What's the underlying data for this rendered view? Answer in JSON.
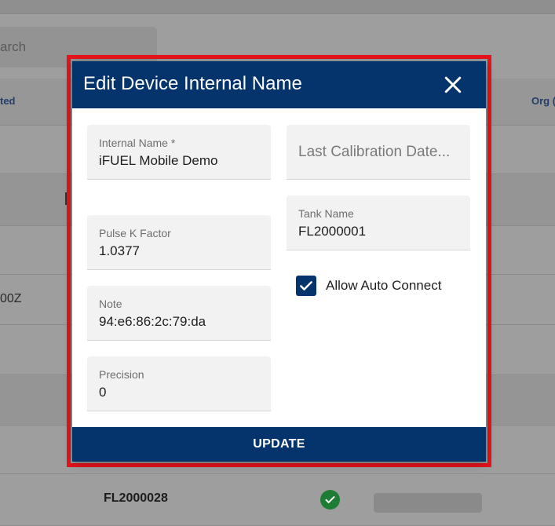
{
  "background": {
    "search_fragment": "arch",
    "column_left_fragment": "ted",
    "column_right_fragment": "Org (",
    "row_text_fragment": "00Z",
    "row_tank_name": "FL2000028"
  },
  "modal": {
    "title": "Edit Device Internal Name",
    "fields": {
      "internal_name": {
        "label": "Internal Name *",
        "value": "iFUEL Mobile Demo"
      },
      "last_calibration": {
        "placeholder": "Last Calibration Date..."
      },
      "tank_name": {
        "label": "Tank Name",
        "value": "FL2000001"
      },
      "pulse_k_factor": {
        "label": "Pulse K Factor",
        "value": "1.0377"
      },
      "note": {
        "label": "Note",
        "value": "94:e6:86:2c:79:da"
      },
      "precision": {
        "label": "Precision",
        "value": "0"
      }
    },
    "allow_auto_connect": {
      "label": "Allow Auto Connect",
      "checked": true
    },
    "update_label": "UPDATE"
  },
  "colors": {
    "header_blue": "#04346b",
    "highlight_red": "#e8141b",
    "success_green": "#1e7d35"
  },
  "icons": [
    "close-icon",
    "check-icon",
    "check-circle-icon"
  ]
}
